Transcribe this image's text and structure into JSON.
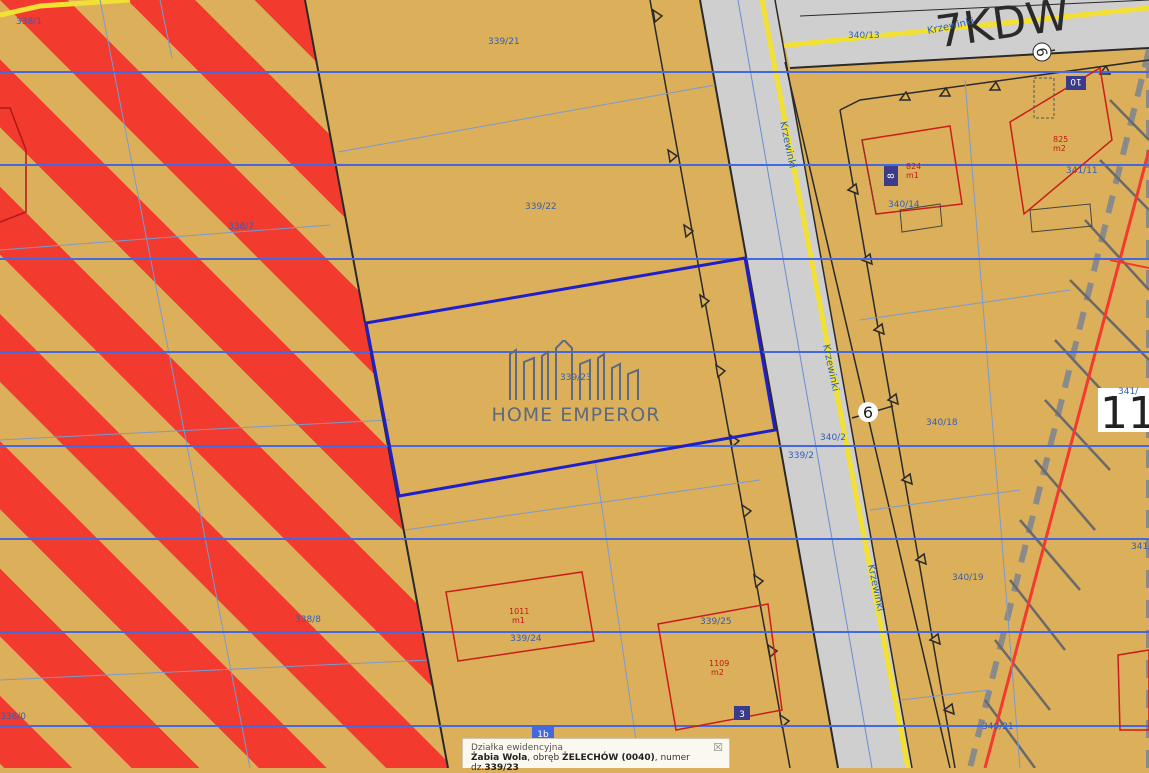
{
  "map": {
    "road_labels": {
      "kdw": "7KDW",
      "krzewinki_top": "Krzewinki",
      "krzewinki_a": "Krzewinki",
      "krzewinki_b": "Krzewinki",
      "krzewinki_c": "Krzewinki",
      "road_no_a": "6",
      "road_no_b": "6",
      "zone_11": "11",
      "plot_1b": "1b"
    },
    "parcels": {
      "p339_21": "339/21",
      "p339_22": "339/22",
      "p339_23": "339/23",
      "p339_24": "339/24",
      "p339_25": "339/25",
      "p339_2": "339/2",
      "p338_7": "338/7",
      "p338_8": "338/8",
      "p338_1": "338/1",
      "p338_0": "338/0",
      "p340_13": "340/13",
      "p340_14": "340/14",
      "p340_18": "340/18",
      "p340_19": "340/19",
      "p340_21": "340/21",
      "p340_2": "340/2",
      "p341_11": "341/11",
      "p341_x": "341/",
      "p341_y": "341/"
    },
    "buildings": {
      "b1011_num": "1011",
      "b1011_type": "m1",
      "b1109_num": "1109",
      "b1109_type": "m2",
      "b824_num": "824",
      "b824_type": "m1",
      "b825_num": "825",
      "b825_type": "m2"
    },
    "address_badges": {
      "a3": "3",
      "a8": "8",
      "a10": "10"
    },
    "colors": {
      "background": "#dcaf5a",
      "hatch_red": "#f23a2e",
      "road_grey": "#cfcfcf",
      "road_yellow": "#f2e034",
      "grid_blue": "#4468e0",
      "selected_parcel": "#2020c8",
      "building_outline": "#cc1c1c"
    }
  },
  "watermark": {
    "text": "HOME EMPEROR"
  },
  "popup": {
    "title": "Działka ewidencyjna",
    "place": "Żabia Wola",
    "precinct_prefix": ", obręb ",
    "precinct": "ŻELECHÓW (0040)",
    "number_prefix": ", numer dz.",
    "number": "339/23",
    "close_symbol": "☒"
  }
}
